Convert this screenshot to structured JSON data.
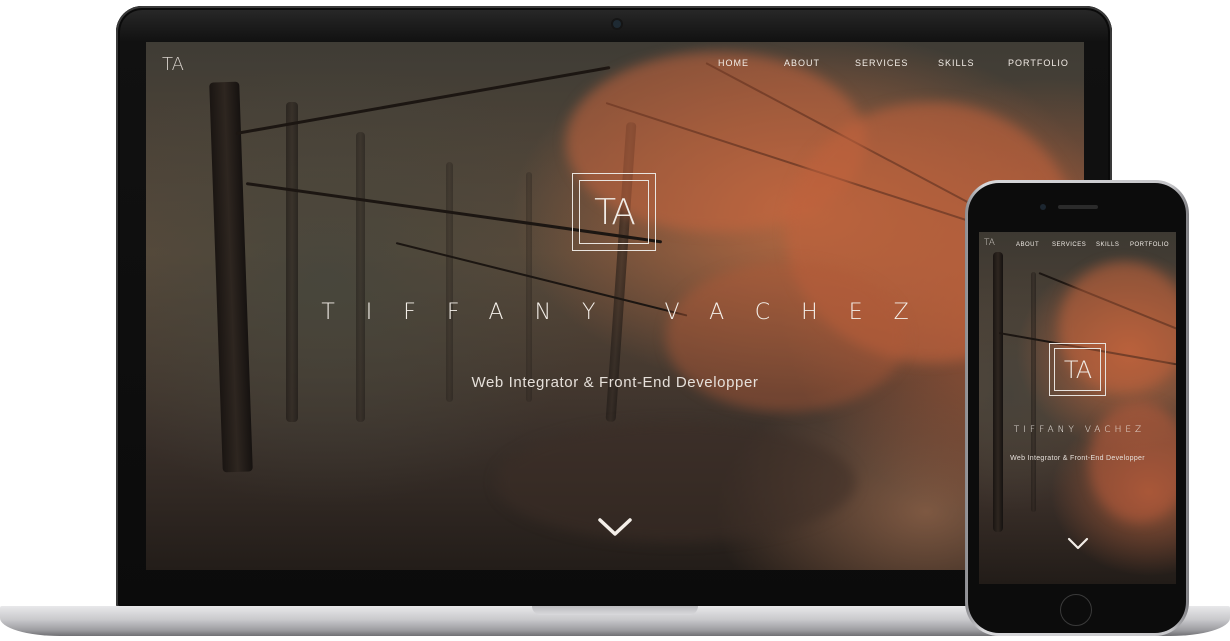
{
  "laptop": {
    "nav": {
      "logo": "TA",
      "items": [
        "HOME",
        "ABOUT",
        "SERVICES",
        "SKILLS",
        "PORTFOLIO"
      ]
    },
    "hero": {
      "logo": "TA",
      "name": "TIFFANY VACHEZ",
      "subtitle": "Web Integrator & Front-End Developper",
      "scroll_icon": "chevron-down-icon"
    }
  },
  "phone": {
    "nav": {
      "logo": "TA",
      "items": [
        "ABOUT",
        "SERVICES",
        "SKILLS",
        "PORTFOLIO"
      ]
    },
    "hero": {
      "logo": "TA",
      "name": "TIFFANY VACHEZ",
      "subtitle": "Web Integrator & Front-End Developper",
      "scroll_icon": "chevron-down-icon"
    }
  },
  "colors": {
    "text": "#f2ece6",
    "foliage": "#c0653f",
    "device_dark": "#0c0c0c",
    "device_silver": "#c9c9cc"
  }
}
